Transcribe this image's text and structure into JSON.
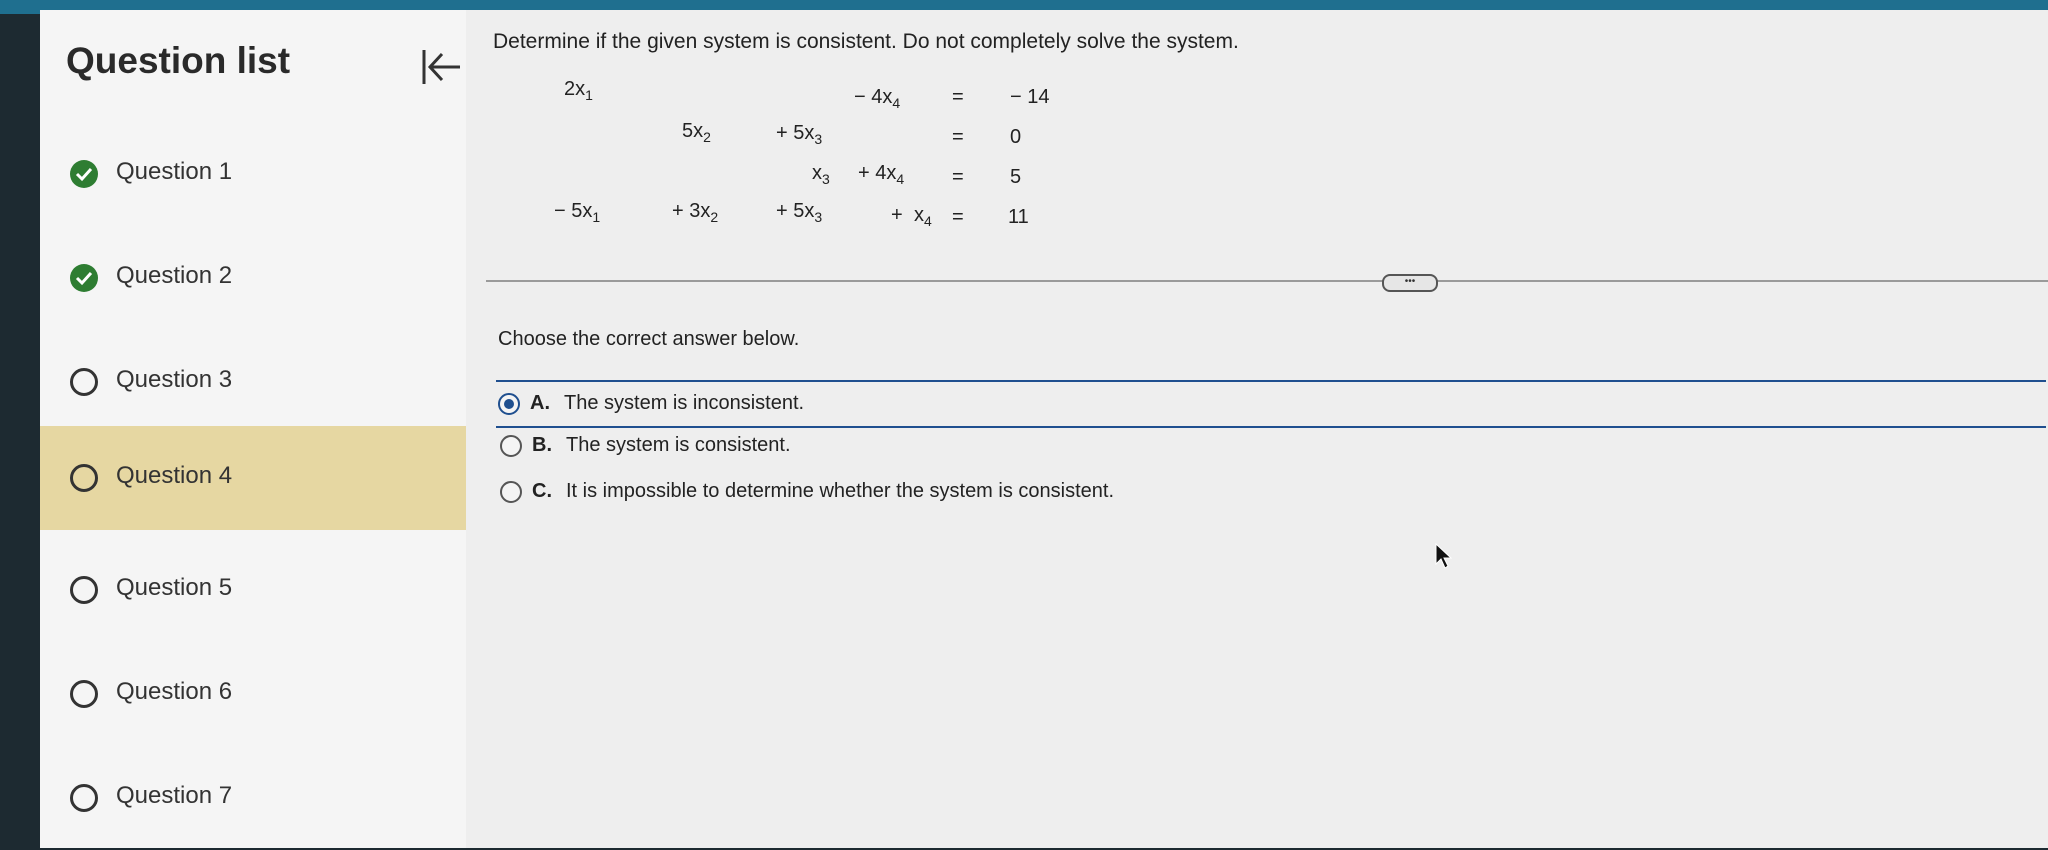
{
  "sidebar": {
    "title": "Question list",
    "questions": [
      {
        "label": "Question 1",
        "status": "done"
      },
      {
        "label": "Question 2",
        "status": "done"
      },
      {
        "label": "Question 3",
        "status": "open"
      },
      {
        "label": "Question 4",
        "status": "open",
        "current": true
      },
      {
        "label": "Question 5",
        "status": "open"
      },
      {
        "label": "Question 6",
        "status": "open"
      },
      {
        "label": "Question 7",
        "status": "open"
      }
    ]
  },
  "question": {
    "prompt": "Determine if the given system is consistent. Do not completely solve the system.",
    "system": {
      "row1": {
        "x1": "2x",
        "x4": "− 4x",
        "eq": "=",
        "rhs": "− 14"
      },
      "row2": {
        "x2": "5x",
        "x3": "+ 5x",
        "eq": "=",
        "rhs": "0"
      },
      "row3": {
        "x3": "x",
        "x4": "+ 4x",
        "eq": "=",
        "rhs": "5"
      },
      "row4": {
        "x1": "− 5x",
        "x2": "+ 3x",
        "x3": "+ 5x",
        "plus": "+",
        "x4": "x",
        "eq": "=",
        "rhs": "11"
      },
      "subs": {
        "1": "1",
        "2": "2",
        "3": "3",
        "4": "4"
      }
    },
    "more_label": "•••",
    "choose_text": "Choose the correct answer below.",
    "options": [
      {
        "letter": "A.",
        "text": "The system is inconsistent.",
        "selected": true
      },
      {
        "letter": "B.",
        "text": "The system is consistent.",
        "selected": false
      },
      {
        "letter": "C.",
        "text": "It is impossible to determine whether the system is consistent.",
        "selected": false
      }
    ]
  },
  "icons": {
    "collapse": "collapse-left-icon",
    "check": "check-circle-icon",
    "radio": "radio-button-icon",
    "cursor": "mouse-pointer-icon"
  },
  "colors": {
    "done": "#2e7d32",
    "current_row": "#e6d7a2",
    "accent": "#1f4f8f"
  }
}
